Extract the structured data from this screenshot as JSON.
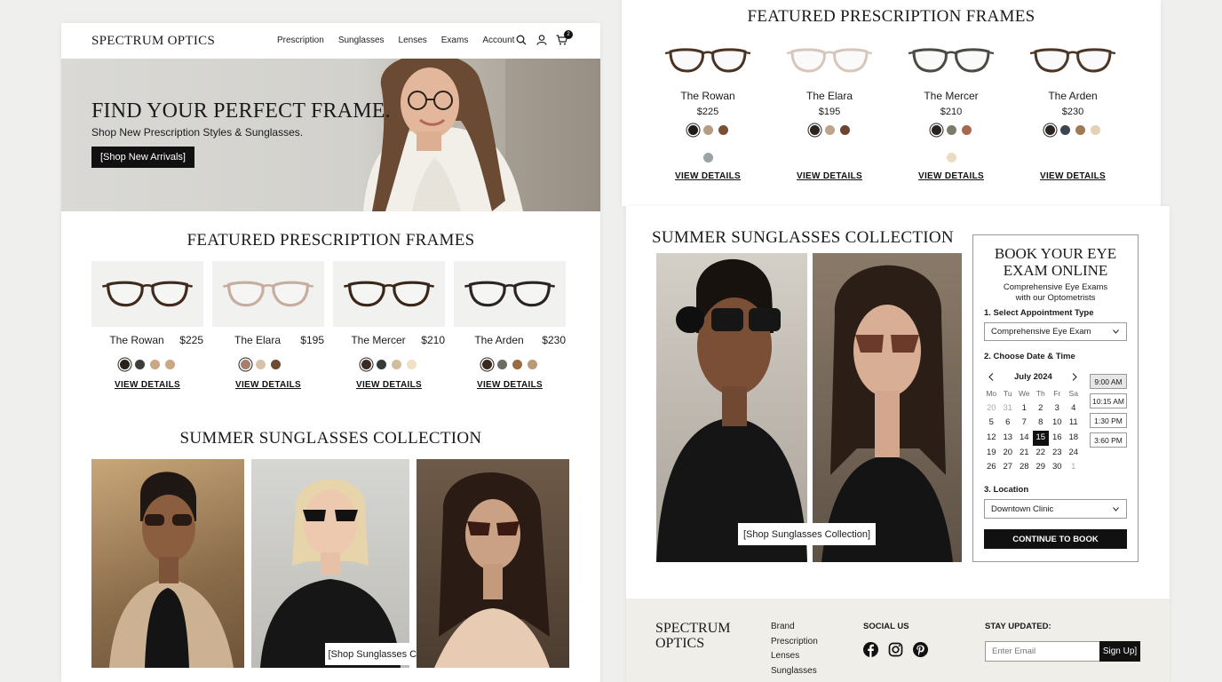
{
  "brand": "SPECTRUM OPTICS",
  "nav": [
    "Prescription",
    "Sunglasses",
    "Lenses",
    "Exams",
    "Account"
  ],
  "cart_count": "2",
  "hero": {
    "title": "FIND YOUR PERFECT FRAME.",
    "subtitle": "Shop New Prescription Styles & Sunglasses.",
    "cta": "[Shop New Arrivals]"
  },
  "featured": {
    "title": "FEATURED PRESCRIPTION FRAMES",
    "view_details": "VIEW DETAILS",
    "frames": [
      {
        "name": "The Rowan",
        "price": "$225",
        "swatches_left": [
          "#2a2119",
          "#3a3f3d",
          "#c7a985",
          "#c9a982"
        ],
        "swatches_right": [
          "#1f1a16",
          "#b59d83",
          "#7b4f34"
        ],
        "extra_right": "#9aa3a6"
      },
      {
        "name": "The Elara",
        "price": "$195",
        "swatches_left": [
          "#a77f6a",
          "#d5c2a8",
          "#6f4a33"
        ],
        "swatches_right": [
          "#2a2520",
          "#bca58a",
          "#6b4530"
        ],
        "extra_right": null
      },
      {
        "name": "The Mercer",
        "price": "$210",
        "swatches_left": [
          "#3b2c20",
          "#353b39",
          "#d3bc9c",
          "#efe0c6"
        ],
        "swatches_right": [
          "#262320",
          "#7b7c6a",
          "#a8684e"
        ],
        "extra_right": "#e8dcc4"
      },
      {
        "name": "The Arden",
        "price": "$230",
        "swatches_left": [
          "#3a2a1c",
          "#6a6d64",
          "#9a6a42",
          "#b89a78"
        ],
        "swatches_right": [
          "#2a2520",
          "#3c4652",
          "#a07a55",
          "#e3d2b5"
        ],
        "extra_right": null
      }
    ]
  },
  "sunglasses": {
    "title": "SUMMER SUNGLASSES COLLECTION",
    "cta": "[Shop Sunglasses Collection]"
  },
  "booking": {
    "title_line1": "BOOK YOUR EYE",
    "title_line2": "EXAM ONLINE",
    "sub_line1": "Comprehensive Eye Exams",
    "sub_line2": "with our Optometrists",
    "step1": "1. Select Appointment Type",
    "appt_value": "Comprehensive Eye Exam",
    "step2": "2. Choose Date & Time",
    "month": "July 2024",
    "weekdays": [
      "Mo",
      "Tu",
      "We",
      "Th",
      "Fr",
      "Sa"
    ],
    "weeks": [
      [
        "20",
        "31",
        "1",
        "2",
        "3",
        "4"
      ],
      [
        "5",
        "6",
        "7",
        "8",
        "10",
        "11"
      ],
      [
        "12",
        "13",
        "14",
        "15",
        "16",
        "18"
      ],
      [
        "19",
        "20",
        "21",
        "22",
        "23",
        "24"
      ],
      [
        "26",
        "27",
        "28",
        "29",
        "30",
        "1"
      ]
    ],
    "selected_day": "15",
    "slots": [
      "9:00 AM",
      "10:15 AM",
      "1:30 PM",
      "3:60 PM"
    ],
    "step3": "3. Location",
    "location_value": "Downtown Clinic",
    "continue": "CONTINUE TO BOOK"
  },
  "footer": {
    "brand_line1": "SPECTRUM",
    "brand_line2": "OPTICS",
    "links": [
      "Brand",
      "Prescription",
      "Lenses",
      "Sunglasses"
    ],
    "social_title": "SOCIAL US",
    "newsletter_title": "STAY UPDATED:",
    "email_placeholder": "Enter Email",
    "signup": "Sign Up]"
  },
  "colors": {
    "accent": "#111111",
    "footer_bg": "#efeee9",
    "hero_bg": "#d9d8d4"
  }
}
